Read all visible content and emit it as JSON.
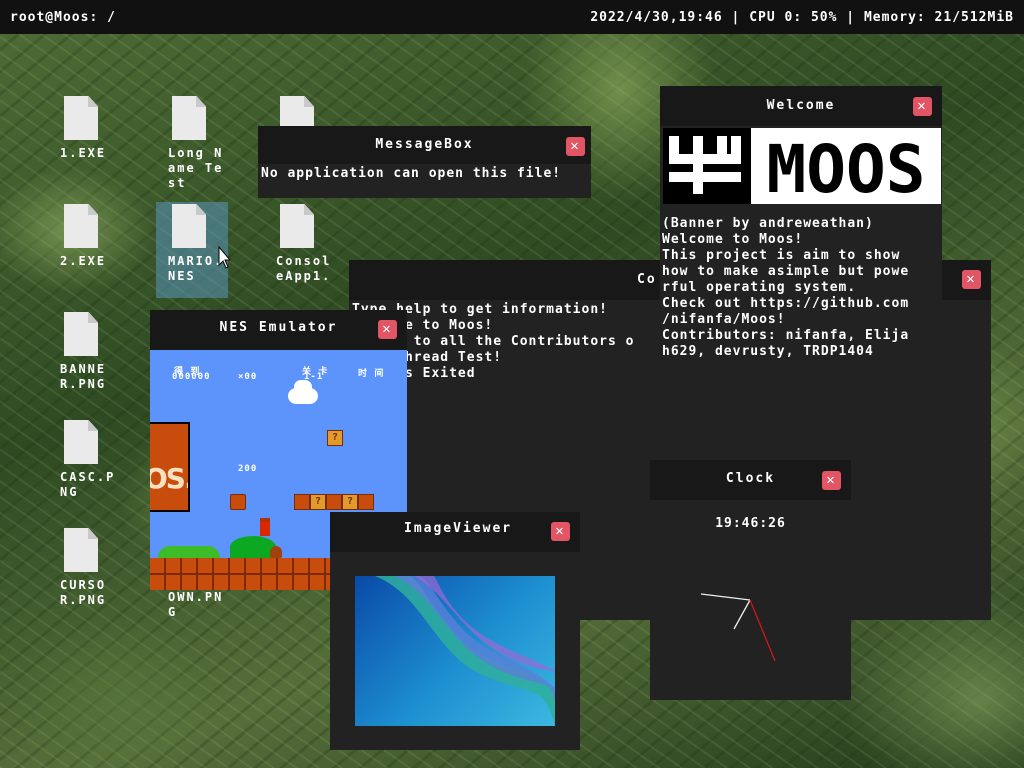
{
  "taskbar": {
    "path": "root@Moos: /",
    "status": "2022/4/30,19:46 | CPU 0: 50% | Memory: 21/512MiB"
  },
  "desktop_icons": [
    {
      "name": "1.EXE"
    },
    {
      "name": "Long Name Test"
    },
    {
      "name": "2.EXE"
    },
    {
      "name": "MARIO.NES"
    },
    {
      "name": "ConsoleApp1."
    },
    {
      "name": "BANNER.PNG"
    },
    {
      "name": "CASC.PNG"
    },
    {
      "name": "CURSOR.PNG"
    },
    {
      "name": "OWN.PNG"
    }
  ],
  "message_box": {
    "title": "MessageBox",
    "text": "No application can open this file!"
  },
  "console": {
    "title": "Co",
    "lines": "Type help to get information!\nWelcome to Moos!\nThanks to all the Contributors o\nLoop Thread Test!\nd 1 Has Exited"
  },
  "welcome": {
    "title": "Welcome",
    "logo_text": "MOOS",
    "text": "(Banner by andreweathan)\nWelcome to Moos!\nThis project is aim to show\nhow to make asimple but powe\nrful operating system.\nCheck out https://github.com\n/nifanfa/Moos!\nContributors: nifanfa, Elija\nh629, devrusty, TRDP1404"
  },
  "nes": {
    "title": "NES Emulator",
    "hud_score_label": "得 到",
    "hud_score": "000000",
    "hud_coins": "×00",
    "hud_world_label": "关 卡",
    "hud_world": "1-1",
    "hud_time_label": "时 间",
    "points_popup": "200",
    "sign_text": "OS."
  },
  "image_viewer": {
    "title": "ImageViewer"
  },
  "clock": {
    "title": "Clock",
    "time": "19:46:26"
  },
  "close_glyph": "✕",
  "colors": {
    "close_button": "#e25564",
    "taskbar": "#111111",
    "window_body": "#222222",
    "window_title": "#181818"
  }
}
